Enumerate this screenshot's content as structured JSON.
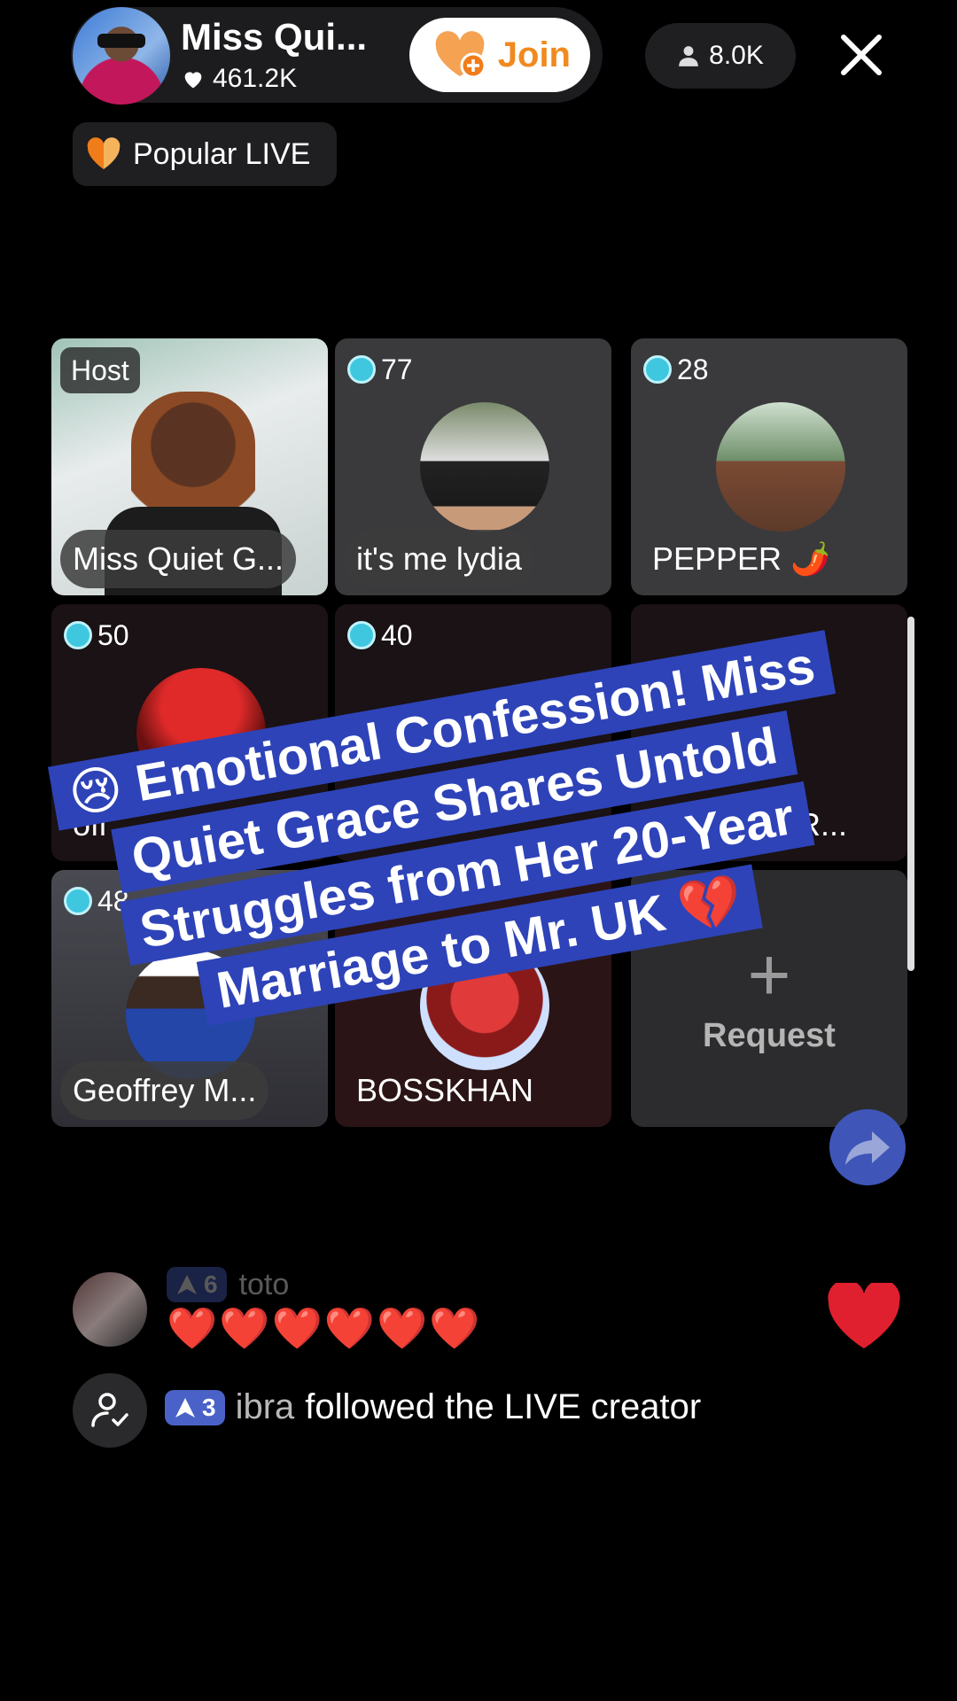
{
  "header": {
    "host_name": "Miss Qui...",
    "host_likes": "461.2K",
    "join_label": "Join",
    "viewer_count": "8.0K",
    "popular_label": "Popular LIVE"
  },
  "grid": {
    "tiles": [
      {
        "tag": "Host",
        "name": "Miss Quiet G..."
      },
      {
        "score": "77",
        "name": "it's me lydia"
      },
      {
        "score": "28",
        "name": "PEPPER 🌶️"
      },
      {
        "score": "50",
        "name": "ofi"
      },
      {
        "score": "40",
        "name": ""
      },
      {
        "score": "",
        "name": "VIR..."
      },
      {
        "score": "48",
        "name": "Geoffrey M..."
      },
      {
        "score": "",
        "name": "BOSSKHAN"
      },
      {
        "request_label": "Request"
      }
    ]
  },
  "caption": {
    "lines": [
      "😢 Emotional Confession! Miss",
      "Quiet Grace Shares Untold",
      "Struggles from Her 20-Year",
      "Marriage to Mr. UK 💔"
    ]
  },
  "chat": {
    "prev_level": "6",
    "prev_user": "toto",
    "prev_message": "❤️❤️❤️❤️❤️❤️",
    "follow_level": "3",
    "follow_user": "ibra",
    "follow_text": "followed the LIVE creator"
  },
  "colors": {
    "caption_bg": "#2e43b8",
    "join_text": "#f08a1e",
    "heart": "#e0202e"
  }
}
